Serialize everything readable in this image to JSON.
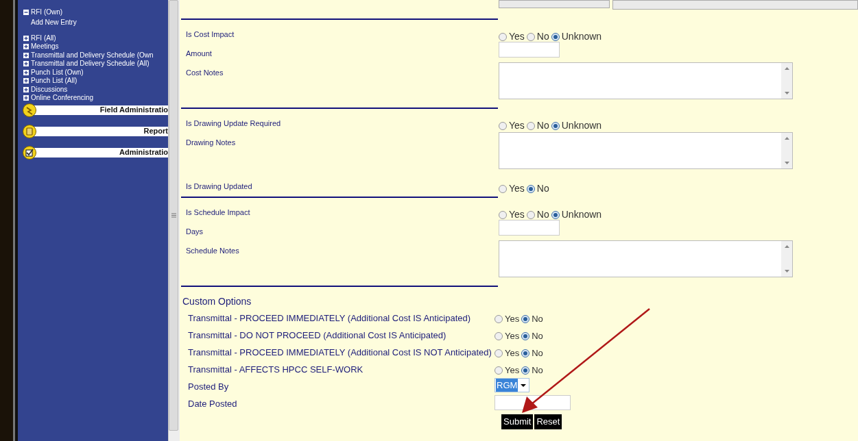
{
  "sidebar": {
    "items": [
      {
        "label": "RFI (Own)",
        "expanded": true,
        "children": [
          {
            "label": "Add New Entry"
          }
        ]
      },
      {
        "label": "RFI (All)",
        "expanded": false
      },
      {
        "label": "Meetings",
        "expanded": false
      },
      {
        "label": "Transmittal and Delivery Schedule (Own",
        "expanded": false
      },
      {
        "label": "Transmittal and Delivery Schedule (All)",
        "expanded": false
      },
      {
        "label": "Punch List (Own)",
        "expanded": false
      },
      {
        "label": "Punch List (All)",
        "expanded": false
      },
      {
        "label": "Discussions",
        "expanded": false
      },
      {
        "label": "Online Conferencing",
        "expanded": false
      }
    ],
    "panels": [
      {
        "title": "Field Administratio"
      },
      {
        "title": "Report"
      },
      {
        "title": "Administratio"
      }
    ]
  },
  "form": {
    "sections": [
      {
        "rows": [
          {
            "kind": "radio",
            "label": "Is Cost Impact",
            "options": [
              {
                "label": "Yes",
                "selected": false
              },
              {
                "label": "No",
                "selected": false
              },
              {
                "label": "Unknown",
                "selected": true
              }
            ]
          },
          {
            "kind": "input",
            "label": "Amount"
          },
          {
            "kind": "textarea",
            "label": "Cost Notes"
          }
        ]
      },
      {
        "rows": [
          {
            "kind": "radio",
            "label": "Is Drawing Update Required",
            "options": [
              {
                "label": "Yes",
                "selected": false
              },
              {
                "label": "No",
                "selected": false
              },
              {
                "label": "Unknown",
                "selected": true
              }
            ]
          },
          {
            "kind": "textarea",
            "label": "Drawing Notes"
          },
          {
            "kind": "radio",
            "label": "Is Drawing Updated",
            "options": [
              {
                "label": "Yes",
                "selected": false
              },
              {
                "label": "No",
                "selected": true
              }
            ]
          }
        ]
      },
      {
        "rows": [
          {
            "kind": "radio",
            "label": "Is Schedule Impact",
            "options": [
              {
                "label": "Yes",
                "selected": false
              },
              {
                "label": "No",
                "selected": false
              },
              {
                "label": "Unknown",
                "selected": true
              }
            ]
          },
          {
            "kind": "input",
            "label": "Days"
          },
          {
            "kind": "textarea",
            "label": "Schedule Notes"
          }
        ]
      }
    ],
    "custom": {
      "title": "Custom Options",
      "rows": [
        {
          "kind": "radio",
          "label": "Transmittal - PROCEED IMMEDIATELY (Additional Cost IS Anticipated)",
          "options": [
            {
              "label": "Yes",
              "selected": false
            },
            {
              "label": "No",
              "selected": true
            }
          ]
        },
        {
          "kind": "radio",
          "label": "Transmittal - DO NOT PROCEED (Additional Cost IS Anticipated)",
          "options": [
            {
              "label": "Yes",
              "selected": false
            },
            {
              "label": "No",
              "selected": true
            }
          ]
        },
        {
          "kind": "radio",
          "label": "Transmittal - PROCEED IMMEDIATELY (Additional Cost IS NOT Anticipated)",
          "options": [
            {
              "label": "Yes",
              "selected": false
            },
            {
              "label": "No",
              "selected": true
            }
          ]
        },
        {
          "kind": "radio",
          "label": "Transmittal - AFFECTS HPCC SELF-WORK",
          "options": [
            {
              "label": "Yes",
              "selected": false
            },
            {
              "label": "No",
              "selected": true
            }
          ]
        },
        {
          "kind": "select",
          "label": "Posted By",
          "value": "RGM"
        },
        {
          "kind": "input",
          "label": "Date Posted"
        }
      ]
    },
    "buttons": [
      "Submit",
      "Reset"
    ]
  }
}
